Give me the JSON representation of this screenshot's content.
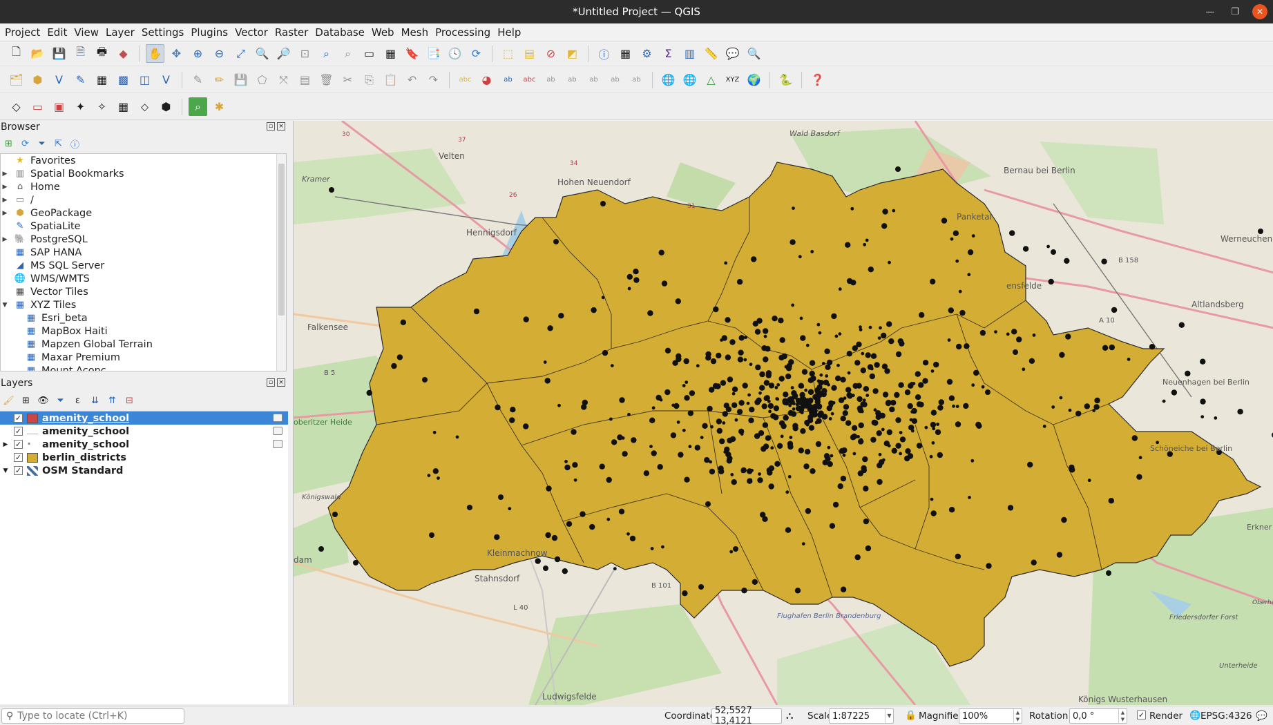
{
  "window": {
    "title": "*Untitled Project — QGIS"
  },
  "menu": [
    "Project",
    "Edit",
    "View",
    "Layer",
    "Settings",
    "Plugins",
    "Vector",
    "Raster",
    "Database",
    "Web",
    "Mesh",
    "Processing",
    "Help"
  ],
  "browser": {
    "title": "Browser",
    "items": [
      {
        "label": "Favorites",
        "icon": "star-icon",
        "expandable": false
      },
      {
        "label": "Spatial Bookmarks",
        "icon": "bookmark-icon",
        "expandable": true
      },
      {
        "label": "Home",
        "icon": "home-folder-icon",
        "expandable": true
      },
      {
        "label": "/",
        "icon": "folder-icon",
        "expandable": true
      },
      {
        "label": "GeoPackage",
        "icon": "geopackage-icon",
        "expandable": true
      },
      {
        "label": "SpatiaLite",
        "icon": "spatialite-icon",
        "expandable": false
      },
      {
        "label": "PostgreSQL",
        "icon": "postgresql-icon",
        "expandable": true
      },
      {
        "label": "SAP HANA",
        "icon": "sap-hana-icon",
        "expandable": false
      },
      {
        "label": "MS SQL Server",
        "icon": "mssql-icon",
        "expandable": false
      },
      {
        "label": "WMS/WMTS",
        "icon": "wms-globe-icon",
        "expandable": false
      },
      {
        "label": "Vector Tiles",
        "icon": "vector-tiles-icon",
        "expandable": false
      },
      {
        "label": "XYZ Tiles",
        "icon": "xyz-tiles-icon",
        "expandable": true,
        "expanded": true
      },
      {
        "label": "Esri_beta",
        "icon": "xyz-tiles-icon",
        "child": true
      },
      {
        "label": "MapBox Haiti",
        "icon": "xyz-tiles-icon",
        "child": true
      },
      {
        "label": "Mapzen Global Terrain",
        "icon": "xyz-tiles-icon",
        "child": true
      },
      {
        "label": "Maxar Premium",
        "icon": "xyz-tiles-icon",
        "child": true
      },
      {
        "label": "Mount Aconc...",
        "icon": "xyz-tiles-icon",
        "child": true
      }
    ]
  },
  "layers": {
    "title": "Layers",
    "items": [
      {
        "label": "amenity_school",
        "checked": true,
        "symbol": "polygon",
        "color": "#cc4646",
        "selected": true,
        "expandable": false,
        "edit_icon": true
      },
      {
        "label": "amenity_school",
        "checked": true,
        "symbol": "line",
        "color": "#b0b0b0",
        "selected": false,
        "expandable": false,
        "edit_icon": true
      },
      {
        "label": "amenity_school",
        "checked": true,
        "symbol": "point",
        "color": "#888888",
        "selected": false,
        "expandable": true,
        "edit_icon": true
      },
      {
        "label": "berlin_districts",
        "checked": true,
        "symbol": "polygon",
        "color": "#d4ae34",
        "selected": false,
        "expandable": false,
        "edit_icon": false
      },
      {
        "label": "OSM Standard",
        "checked": true,
        "symbol": "raster",
        "color": "#4a6d9c",
        "selected": false,
        "expandable": true,
        "edit_icon": false
      }
    ]
  },
  "map": {
    "district_fill": "#d4ae34",
    "place_labels": [
      "Wald Basdorf",
      "Velten",
      "Kramer",
      "Hohen Neuendorf",
      "Bernau bei Berlin",
      "Panketal",
      "Hennigsdorf",
      "Werneuchen",
      "B 158",
      "Falkensee",
      "ensfelde",
      "A 10",
      "Altlandsberg",
      "B 5",
      "Neuenhagen bei Berlin",
      "oberitzer Heide",
      "Schöneiche bei Berlin",
      "Königswald",
      "Erkner",
      "dam",
      "Kleinmachnow",
      "Stahnsdorf",
      "B 101",
      "L 40",
      "Flughafen Berlin Brandenburg",
      "Oberheide",
      "Friedersdorfer Forst",
      "Unterheide",
      "Ludwigsfelde",
      "Königs Wusterhausen",
      "30",
      "37",
      "34",
      "31",
      "26"
    ]
  },
  "status": {
    "locator_placeholder": "Type to locate (Ctrl+K)",
    "coordinate_label": "Coordinate",
    "coordinate": "52,5527 13,4121",
    "scale_label": "Scale",
    "scale": "1:87225",
    "magnifier_label": "Magnifier",
    "magnifier": "100%",
    "rotation_label": "Rotation",
    "rotation": "0,0 °",
    "render_label": "Render",
    "render_checked": true,
    "crs": "EPSG:4326"
  }
}
